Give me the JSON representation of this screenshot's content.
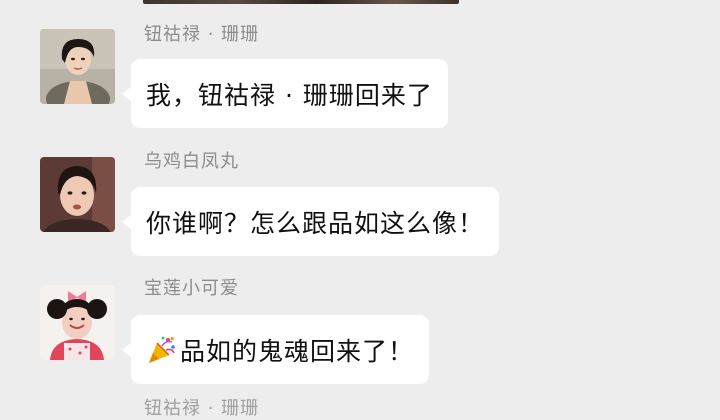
{
  "messages": [
    {
      "sender": "钮祜禄 · 珊珊",
      "text": "我，钮祜禄 · 珊珊回来了",
      "avatar": "avatar-woman-short-hair"
    },
    {
      "sender": "乌鸡白凤丸",
      "text": "你谁啊？怎么跟品如这么像！",
      "avatar": "avatar-woman-surprised"
    },
    {
      "sender": "宝莲小可爱",
      "emoji": "party-popper-icon",
      "text": "品如的鬼魂回来了！",
      "avatar": "avatar-woman-pink-bow"
    }
  ],
  "cut_off_sender": "钮祜禄 · 珊珊",
  "colors": {
    "background": "#ededed",
    "bubble": "#ffffff",
    "sender_name": "#8c8c8c",
    "message_text": "#111111"
  }
}
